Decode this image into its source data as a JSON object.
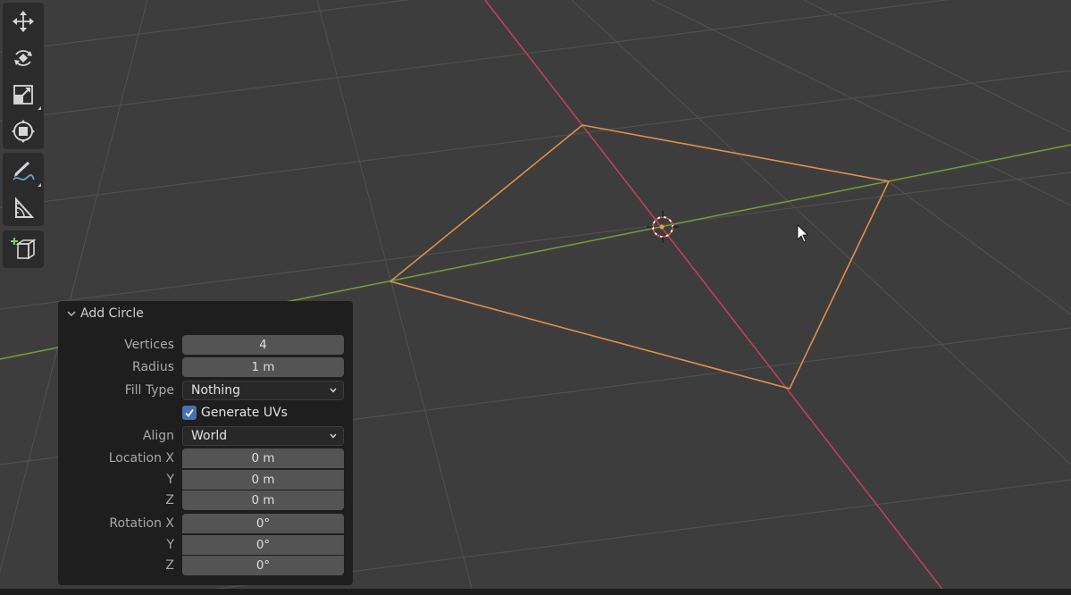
{
  "toolbar": {
    "tools": [
      {
        "name": "move-tool",
        "icon": "move-icon"
      },
      {
        "name": "rotate-tool",
        "icon": "rotate-icon"
      },
      {
        "name": "scale-tool",
        "icon": "scale-icon"
      },
      {
        "name": "transform-tool",
        "icon": "transform-icon"
      },
      {
        "name": "annotate-tool",
        "icon": "annotate-icon"
      },
      {
        "name": "measure-tool",
        "icon": "measure-icon"
      },
      {
        "name": "add-cube-tool",
        "icon": "add-cube-icon"
      }
    ]
  },
  "panel": {
    "title": "Add Circle",
    "vertices_label": "Vertices",
    "vertices_value": "4",
    "radius_label": "Radius",
    "radius_value": "1 m",
    "fill_type_label": "Fill Type",
    "fill_type_value": "Nothing",
    "generate_uvs_label": "Generate UVs",
    "generate_uvs_checked": true,
    "align_label": "Align",
    "align_value": "World",
    "location_x_label": "Location X",
    "location_x_value": "0 m",
    "location_y_label": "Y",
    "location_y_value": "0 m",
    "location_z_label": "Z",
    "location_z_value": "0 m",
    "rotation_x_label": "Rotation X",
    "rotation_x_value": "0°",
    "rotation_y_label": "Y",
    "rotation_y_value": "0°",
    "rotation_z_label": "Z",
    "rotation_z_value": "0°"
  },
  "colors": {
    "viewport_bg": "#3d3d3d",
    "grid_line": "#4f4f4f",
    "x_axis": "#c0405a",
    "y_axis": "#6f9a3c",
    "selection": "#e0904a",
    "panel_bg": "#1e1e1e",
    "field_bg": "#545454",
    "checkbox_accent": "#4772b3"
  }
}
